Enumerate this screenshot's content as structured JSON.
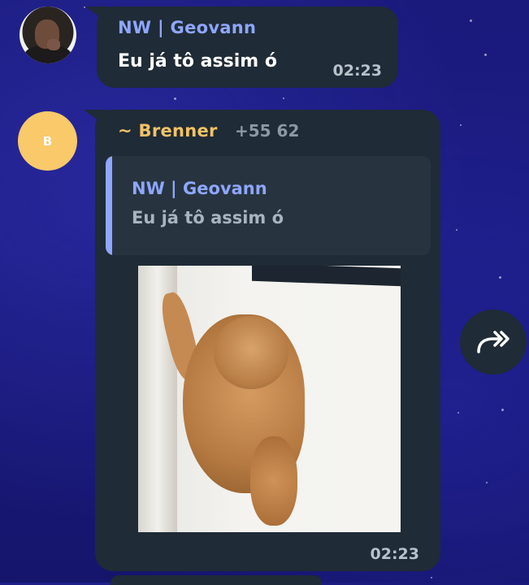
{
  "messages": [
    {
      "sender": "NW | Geovann",
      "text": "Eu já tô assim ó",
      "time": "02:23"
    },
    {
      "sender": "~ Brenner",
      "phone": "+55 62",
      "avatar_initial": "B",
      "reply_to": {
        "sender": "NW | Geovann",
        "text": "Eu já tô assim ó"
      },
      "media": "dog-gif",
      "time": "02:23"
    }
  ],
  "colors": {
    "background": "#1a1a7c",
    "bubble": "#1f2b36",
    "sender_blue": "#8fa6ff",
    "sender_gold": "#f3c267",
    "avatar_gold": "#f9c96a"
  },
  "icons": {
    "forward": "double-arrow-forward-icon"
  }
}
